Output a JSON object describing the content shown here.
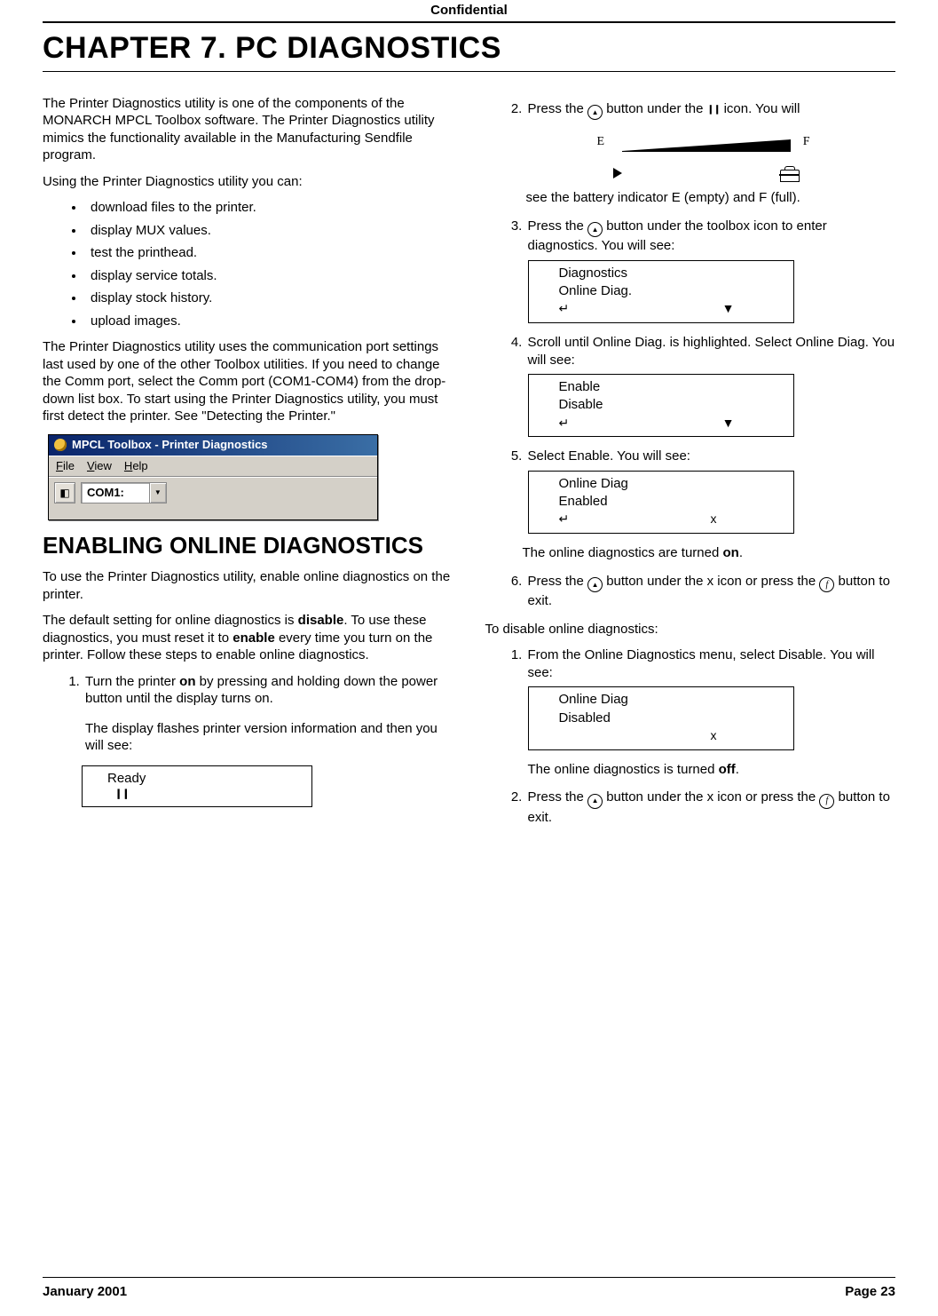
{
  "header": {
    "confidential": "Confidential"
  },
  "chapter": {
    "title": "CHAPTER 7.  PC DIAGNOSTICS"
  },
  "left": {
    "p1": "The Printer Diagnostics utility is one of the components of the MONARCH MPCL Toolbox software.  The Printer Diagnostics utility mimics the functionality available in the Manufacturing Sendfile program.",
    "p2": "Using the Printer Diagnostics utility you can:",
    "bullets": [
      "download files to the printer.",
      "display MUX values.",
      "test the printhead.",
      "display service totals.",
      "display stock history.",
      "upload images."
    ],
    "p3": "The Printer Diagnostics utility uses the communication port settings last used by one of the other Toolbox utilities.  If you need to change the Comm port, select the Comm port (COM1-COM4) from the drop-down list box.  To start using the Printer Diagnostics utility, you must first detect the printer.  See \"Detecting the Printer.\"",
    "toolbox": {
      "title": "MPCL Toolbox - Printer Diagnostics",
      "menu": {
        "file": "File",
        "view": "View",
        "help": "Help"
      },
      "combo": "COM1:"
    },
    "h2": "ENABLING ONLINE DIAGNOSTICS",
    "p4": "To use the Printer Diagnostics utility, enable online diagnostics on the printer.",
    "p5a": "The default setting for online diagnostics is ",
    "p5b_bold": "disable",
    "p5c": ".  To use these diagnostics, you must reset it to ",
    "p5d_bold": "enable",
    "p5e": " every time you turn on the printer.  Follow these steps to enable online diagnostics.",
    "step1a": "Turn the printer ",
    "step1_on": "on",
    "step1b": " by pressing and holding down the power button until the display turns on.",
    "step1c": "The display flashes printer version information and then you will see:",
    "lcd_ready": "Ready",
    "pause_glyph": "❙❙"
  },
  "right": {
    "step2a": "Press the ",
    "step2b": " button under the ",
    "step2c": " icon.  You will",
    "battery": {
      "E": "E",
      "F": "F"
    },
    "step2d": "see the battery indicator E (empty) and F (full).",
    "step3a": "Press the ",
    "step3b": " button under the toolbox icon to enter diagnostics.  You will see:",
    "lcd1": {
      "l1": "Diagnostics",
      "l2": "Online Diag.",
      "enter": "↵",
      "down": "▼"
    },
    "step4": "Scroll until Online Diag. is highlighted.  Select Online Diag.  You will see:",
    "lcd2": {
      "l1": "Enable",
      "l2": "Disable",
      "enter": "↵",
      "down": "▼"
    },
    "step5": "Select Enable.  You will see:",
    "lcd3": {
      "l1": "Online Diag",
      "l2": "Enabled",
      "enter": "↵",
      "x": "x"
    },
    "step5_result_a": "The online diagnostics are turned ",
    "step5_result_on": "on",
    "step5_result_b": ".",
    "step6a": "Press the ",
    "step6b": " button under the x icon or press the ",
    "step6c": " button to exit.",
    "disable_intro": "To disable online diagnostics:",
    "d1": "From the Online Diagnostics menu, select Disable.  You will see:",
    "lcd4": {
      "l1": "Online Diag",
      "l2": "Disabled",
      "x": "x"
    },
    "d1_result_a": "The online diagnostics is turned ",
    "d1_result_off": "off",
    "d1_result_b": ".",
    "d2a": "Press the ",
    "d2b": " button under the x icon or press the ",
    "d2c": " button to exit."
  },
  "footer": {
    "date": "January 2001",
    "page": "Page 23"
  }
}
